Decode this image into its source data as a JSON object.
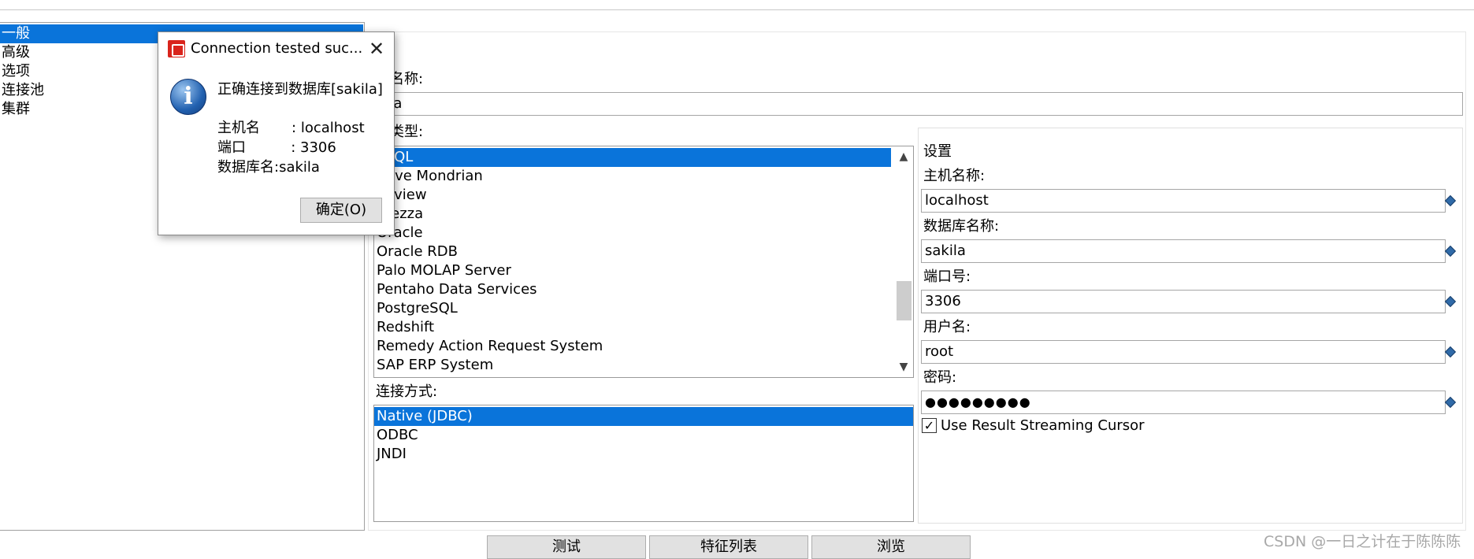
{
  "categories": [
    {
      "label": "一般",
      "selected": true
    },
    {
      "label": "高级",
      "selected": false
    },
    {
      "label": "选项",
      "selected": false
    },
    {
      "label": "连接池",
      "selected": false
    },
    {
      "label": "集群",
      "selected": false
    }
  ],
  "connection_name": {
    "label": "接名称:",
    "value": "kila"
  },
  "connection_type": {
    "label": "接类型:",
    "items": [
      {
        "label": "ySQL",
        "selected": true
      },
      {
        "label": "ative Mondrian",
        "selected": false
      },
      {
        "label": "eoview",
        "selected": false
      },
      {
        "label": "etezza",
        "selected": false
      },
      {
        "label": "Oracle",
        "selected": false
      },
      {
        "label": "Oracle RDB",
        "selected": false
      },
      {
        "label": "Palo MOLAP Server",
        "selected": false
      },
      {
        "label": "Pentaho Data Services",
        "selected": false
      },
      {
        "label": "PostgreSQL",
        "selected": false
      },
      {
        "label": "Redshift",
        "selected": false
      },
      {
        "label": "Remedy Action Request System",
        "selected": false
      },
      {
        "label": "SAP ERP System",
        "selected": false
      }
    ]
  },
  "access_method": {
    "label": "连接方式:",
    "items": [
      {
        "label": "Native (JDBC)",
        "selected": true
      },
      {
        "label": "ODBC",
        "selected": false
      },
      {
        "label": "JNDI",
        "selected": false
      }
    ]
  },
  "settings": {
    "title": "设置",
    "host_label": "主机名称:",
    "host_value": "localhost",
    "db_label": "数据库名称:",
    "db_value": "sakila",
    "port_label": "端口号:",
    "port_value": "3306",
    "user_label": "用户名:",
    "user_value": "root",
    "password_label": "密码:",
    "password_value": "●●●●●●●●●",
    "streaming_label": "Use Result Streaming Cursor",
    "streaming_checked": "✓"
  },
  "buttons": {
    "test": "测试",
    "features": "特征列表",
    "browse": "浏览"
  },
  "watermark": "CSDN @一日之计在于陈陈陈",
  "dialog": {
    "title": "Connection tested suc...",
    "message": "正确连接到数据库[sakila]",
    "host_line": "主机名       : localhost",
    "port_line": "端口          : 3306",
    "db_line": "数据库名:sakila",
    "ok_label": "确定(O)"
  }
}
